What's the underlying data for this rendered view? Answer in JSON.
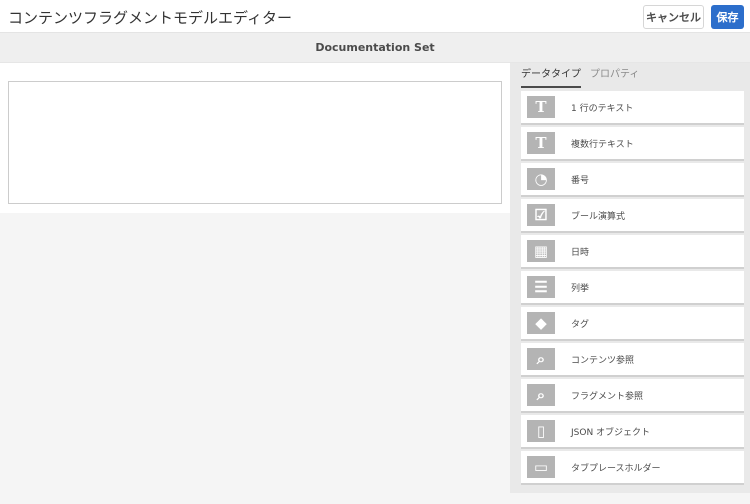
{
  "header": {
    "title": "コンテンツフラグメントモデルエディター",
    "cancel_label": "キャンセル",
    "save_label": "保存"
  },
  "model_name": "Documentation Set",
  "sidebar": {
    "tabs": [
      {
        "label": "データタイプ",
        "active": true
      },
      {
        "label": "プロパティ",
        "active": false
      }
    ],
    "items": [
      {
        "label": "1 行のテキスト",
        "icon": "text-icon"
      },
      {
        "label": "複数行テキスト",
        "icon": "text-icon"
      },
      {
        "label": "番号",
        "icon": "gauge-icon"
      },
      {
        "label": "ブール演算式",
        "icon": "checkbox-icon"
      },
      {
        "label": "日時",
        "icon": "calendar-icon"
      },
      {
        "label": "列挙",
        "icon": "list-icon"
      },
      {
        "label": "タグ",
        "icon": "tag-icon"
      },
      {
        "label": "コンテンツ参照",
        "icon": "folder-search-icon"
      },
      {
        "label": "フラグメント参照",
        "icon": "folder-search-icon"
      },
      {
        "label": "JSON オブジェクト",
        "icon": "json-file-icon"
      },
      {
        "label": "タブプレースホルダー",
        "icon": "tab-icon"
      }
    ]
  }
}
